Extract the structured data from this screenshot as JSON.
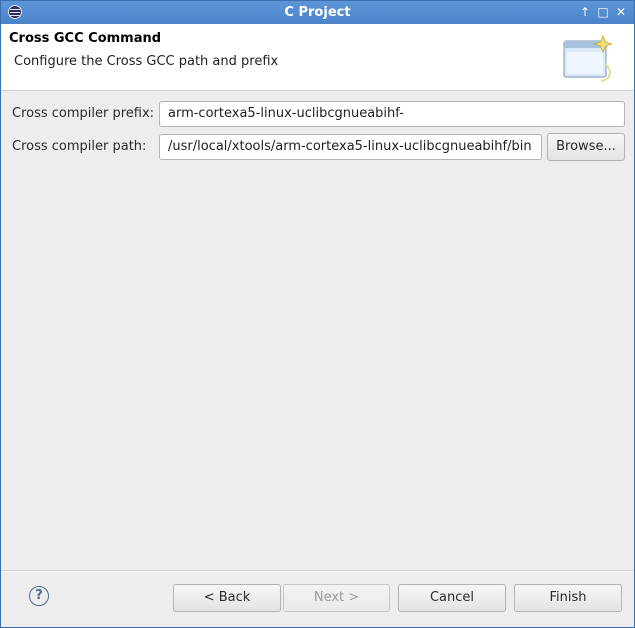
{
  "window": {
    "title": "C Project",
    "controls": {
      "minimize": "↑",
      "maximize": "□",
      "close": "✕"
    }
  },
  "banner": {
    "title": "Cross GCC Command",
    "description": "Configure the Cross GCC path and prefix",
    "icon": "wizard-banner-icon"
  },
  "form": {
    "prefix_label": "Cross compiler prefix:",
    "prefix_value": "arm-cortexa5-linux-uclibcgnueabihf-",
    "path_label": "Cross compiler path:",
    "path_value": "/usr/local/xtools/arm-cortexa5-linux-uclibcgnueabihf/bin",
    "browse_label": "Browse..."
  },
  "footer": {
    "help_symbol": "?",
    "back_label": "< Back",
    "next_label": "Next >",
    "cancel_label": "Cancel",
    "finish_label": "Finish"
  },
  "colors": {
    "titlebar": "#4a83c8",
    "dialog_background": "#ededed",
    "banner_background": "#ffffff"
  }
}
